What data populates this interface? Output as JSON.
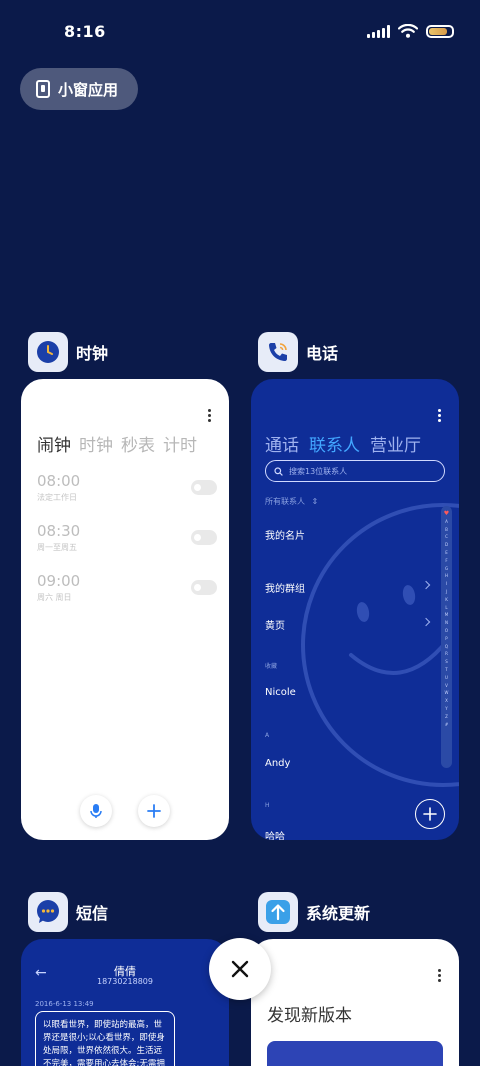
{
  "status_bar": {
    "time": "8:16",
    "battery_level": 0.8
  },
  "floating_window_button": {
    "label": "小窗应用"
  },
  "apps": {
    "clock": {
      "name": "时钟",
      "tabs": [
        "闹钟",
        "时钟",
        "秒表",
        "计时"
      ],
      "active_tab": 0,
      "alarms": [
        {
          "time": "08:00",
          "sub": "法定工作日",
          "on": false
        },
        {
          "time": "08:30",
          "sub": "周一至周五",
          "on": false
        },
        {
          "time": "09:00",
          "sub": "周六 周日",
          "on": false
        }
      ]
    },
    "phone": {
      "name": "电话",
      "tabs": [
        "通话",
        "联系人",
        "营业厅"
      ],
      "active_tab": 1,
      "search_placeholder": "搜索13位联系人",
      "filter_label": "所有联系人",
      "rows": {
        "my_card": "我的名片",
        "my_groups": "我的群组",
        "yellow_pages": "黄页",
        "favorites_header": "收藏",
        "nicole": "Nicole",
        "a_header": "A",
        "andy": "Andy",
        "h_header": "H",
        "haha": "哈哈"
      },
      "alphabet": [
        "♥",
        "A",
        "B",
        "C",
        "D",
        "E",
        "F",
        "G",
        "H",
        "I",
        "J",
        "K",
        "L",
        "M",
        "N",
        "O",
        "P",
        "Q",
        "R",
        "S",
        "T",
        "U",
        "V",
        "W",
        "X",
        "Y",
        "Z",
        "#"
      ]
    },
    "sms": {
      "name": "短信",
      "contact_name": "倩倩",
      "contact_number": "18730218809",
      "date": "2016-6-13 13:49",
      "message": "以眼看世界，即使站的最高，世界还是很小;以心看世界，即使身处局限，世界依然很大。生活远不完美，需要用心去体会;无需拥有太多"
    },
    "system_update": {
      "name": "系统更新",
      "title": "发现新版本"
    }
  },
  "colors": {
    "background": "#0b1a4a",
    "phone_card": "#0f2d97",
    "accent": "#42a6ff"
  }
}
